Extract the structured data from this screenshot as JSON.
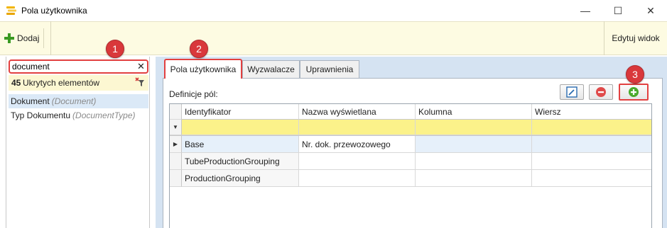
{
  "window": {
    "title": "Pola użytkownika",
    "minimize_glyph": "—",
    "maximize_glyph": "☐",
    "close_glyph": "✕"
  },
  "toolbar": {
    "add_label": "Dodaj",
    "edit_view_label": "Edytuj widok"
  },
  "left_panel": {
    "search_value": "document",
    "search_clear_glyph": "✕",
    "hidden_count": "45",
    "hidden_label": "Ukrytych elementów",
    "items": [
      {
        "name": "Dokument",
        "type": "(Document)"
      },
      {
        "name": "Typ Dokumentu",
        "type": "(DocumentType)"
      }
    ]
  },
  "tabs": [
    {
      "label": "Pola użytkownika",
      "active": true
    },
    {
      "label": "Wyzwalacze",
      "active": false
    },
    {
      "label": "Uprawnienia",
      "active": false
    }
  ],
  "definitions": {
    "label": "Definicje pól:",
    "columns": [
      "Identyfikator",
      "Nazwa wyświetlana",
      "Kolumna",
      "Wiersz"
    ],
    "filter_glyph": "▼",
    "current_row_glyph": "▶",
    "rows": [
      [
        "Base",
        "Nr. dok. przewozowego",
        "",
        ""
      ],
      [
        "TubeProductionGrouping",
        "",
        "",
        ""
      ],
      [
        "ProductionGrouping",
        "",
        "",
        ""
      ]
    ]
  },
  "markers": [
    "1",
    "2",
    "3"
  ],
  "colors": {
    "accent_red": "#e24040",
    "toolbar_bg": "#fdfbe2",
    "filter_row": "#fbf28a",
    "panel_blue": "#d5e3f2",
    "add_green": "#3a9a22"
  },
  "icons": [
    "app-icon",
    "plus-icon",
    "filter-icon",
    "edit-icon",
    "delete-icon",
    "add-icon"
  ]
}
